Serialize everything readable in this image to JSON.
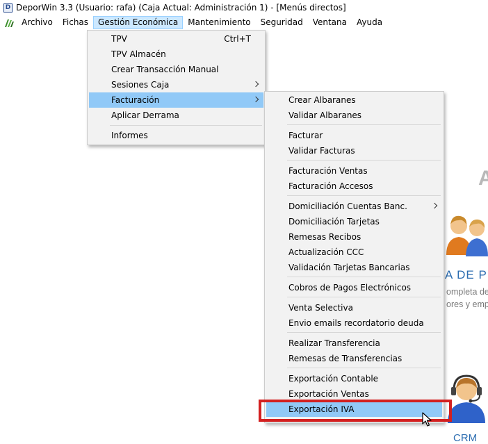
{
  "window": {
    "title": "DeporWin 3.3  (Usuario: rafa)  (Caja Actual: Administración 1) - [Menús directos]",
    "app_icon_letter": "D"
  },
  "menubar": {
    "logo_icon": "app-logo-icon",
    "items": [
      "Archivo",
      "Fichas",
      "Gestión Económica",
      "Mantenimiento",
      "Seguridad",
      "Ventana",
      "Ayuda"
    ],
    "active": "Gestión Económica"
  },
  "gestion_menu": {
    "items": [
      {
        "label": "TPV",
        "shortcut": "Ctrl+T"
      },
      {
        "label": "TPV Almacén"
      },
      {
        "label": "Crear Transacción Manual"
      },
      {
        "label": "Sesiones Caja",
        "submenu": true
      },
      {
        "label": "Facturación",
        "submenu": true,
        "highlighted": true
      },
      {
        "label": "Aplicar Derrama"
      },
      {
        "label": "Informes"
      }
    ]
  },
  "facturacion_menu": {
    "items": [
      {
        "label": "Crear Albaranes"
      },
      {
        "label": "Validar Albaranes"
      },
      {
        "label": "Facturar"
      },
      {
        "label": "Validar Facturas"
      },
      {
        "label": "Facturación Ventas"
      },
      {
        "label": "Facturación Accesos"
      },
      {
        "label": "Domiciliación Cuentas Banc.",
        "submenu": true
      },
      {
        "label": "Domiciliación Tarjetas"
      },
      {
        "label": "Remesas Recibos"
      },
      {
        "label": "Actualización CCC"
      },
      {
        "label": "Validación Tarjetas Bancarias"
      },
      {
        "label": "Cobros de Pagos Electrónicos"
      },
      {
        "label": "Venta Selectiva"
      },
      {
        "label": "Envio emails recordatorio deuda"
      },
      {
        "label": "Realizar Transferencia"
      },
      {
        "label": "Remesas de Transferencias"
      },
      {
        "label": "Exportación Contable"
      },
      {
        "label": "Exportación Ventas"
      },
      {
        "label": "Exportación IVA",
        "highlighted": true
      }
    ]
  },
  "background": {
    "letter": "A",
    "section_title": "A DE PE",
    "section_desc_line1": "ompleta de",
    "section_desc_line2": "ores y emp",
    "people_icon": "people-icon",
    "crm_icon": "headset-support-icon",
    "crm_label": "CRM"
  },
  "annotation": {
    "color": "#d32020"
  },
  "colors": {
    "highlight": "#91c9f7",
    "menu_bg": "#f2f2f2",
    "menubar_active": "#cce8ff",
    "link_blue": "#2b6cb0"
  }
}
